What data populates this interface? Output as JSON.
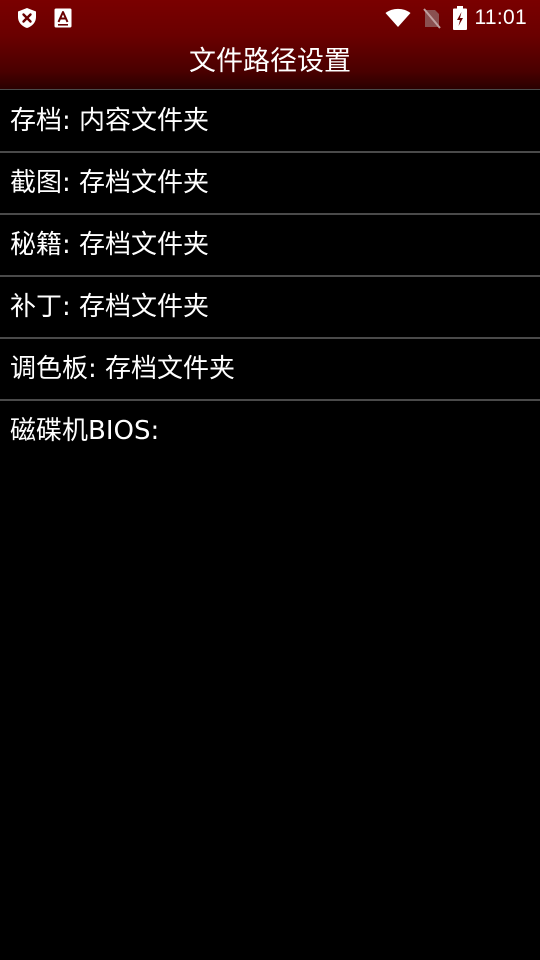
{
  "status_bar": {
    "time": "11:01",
    "left_icons": [
      "shield-x-icon",
      "font-a-icon"
    ],
    "right_icons": [
      "wifi-icon",
      "no-sim-icon",
      "battery-charging-icon"
    ]
  },
  "header": {
    "title": "文件路径设置"
  },
  "colors": {
    "header_top": "#7a0000",
    "header_bottom": "#2a0000",
    "background": "#000000",
    "divider": "#4a4a4a",
    "text": "#ffffff"
  },
  "settings": {
    "items": [
      {
        "label": "存档: 内容文件夹"
      },
      {
        "label": "截图: 存档文件夹"
      },
      {
        "label": "秘籍: 存档文件夹"
      },
      {
        "label": "补丁: 存档文件夹"
      },
      {
        "label": "调色板: 存档文件夹"
      },
      {
        "label": "磁碟机BIOS:"
      }
    ]
  }
}
